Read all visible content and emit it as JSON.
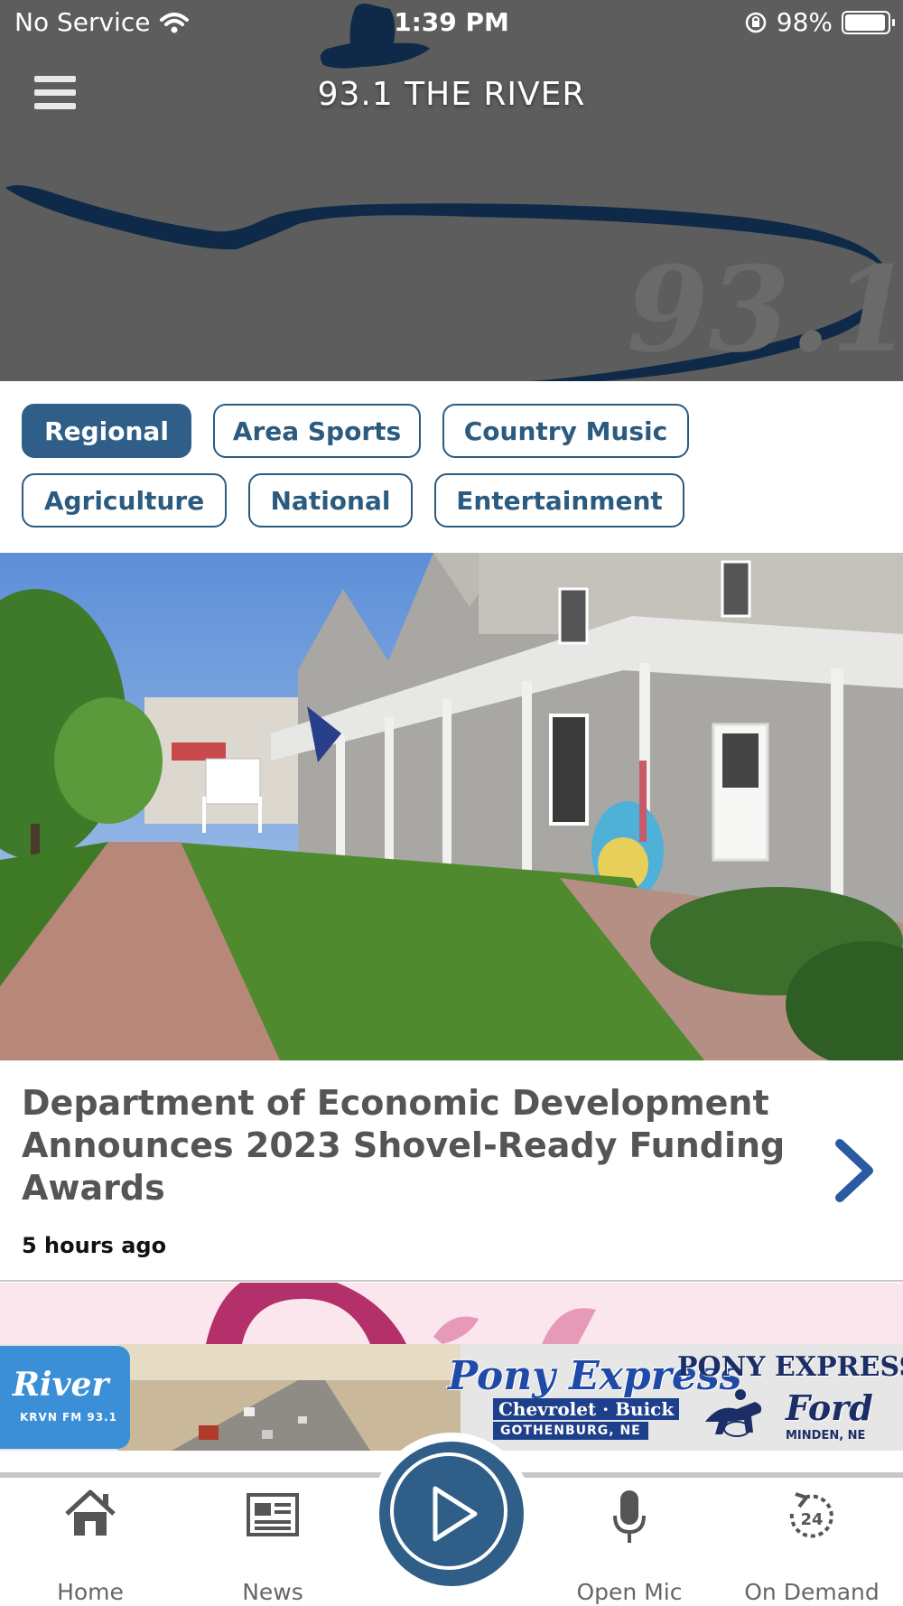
{
  "status_bar": {
    "carrier": "No Service",
    "time": "1:39 PM",
    "battery": "98%"
  },
  "header": {
    "title": "93.1 THE RIVER",
    "logo_text": "93.1",
    "colors": {
      "header_bg": "#5d5d5d",
      "logo_navy": "#0e2a48"
    }
  },
  "categories": [
    {
      "label": "Regional",
      "active": true
    },
    {
      "label": "Area Sports",
      "active": false
    },
    {
      "label": "Country Music",
      "active": false
    },
    {
      "label": "Agriculture",
      "active": false
    },
    {
      "label": "National",
      "active": false
    },
    {
      "label": "Entertainment",
      "active": false
    }
  ],
  "article": {
    "title": "Department of Economic Development Announces 2023 Shovel-Ready Funding Awards",
    "time_ago": "5 hours ago"
  },
  "ad": {
    "river_logo": "River",
    "river_sub": "KRVN FM 93.1",
    "pony1_name": "Pony Express",
    "pony1_make": "Chevrolet · Buick",
    "pony1_city": "GOTHENBURG, NE",
    "pony2_name": "PONY EXPRESS",
    "pony2_make": "Ford",
    "pony2_city": "MINDEN, NE"
  },
  "nav": {
    "home": "Home",
    "news": "News",
    "open_mic": "Open Mic",
    "on_demand": "On Demand",
    "on_demand_badge": "24"
  },
  "accent": "#2f5f88"
}
